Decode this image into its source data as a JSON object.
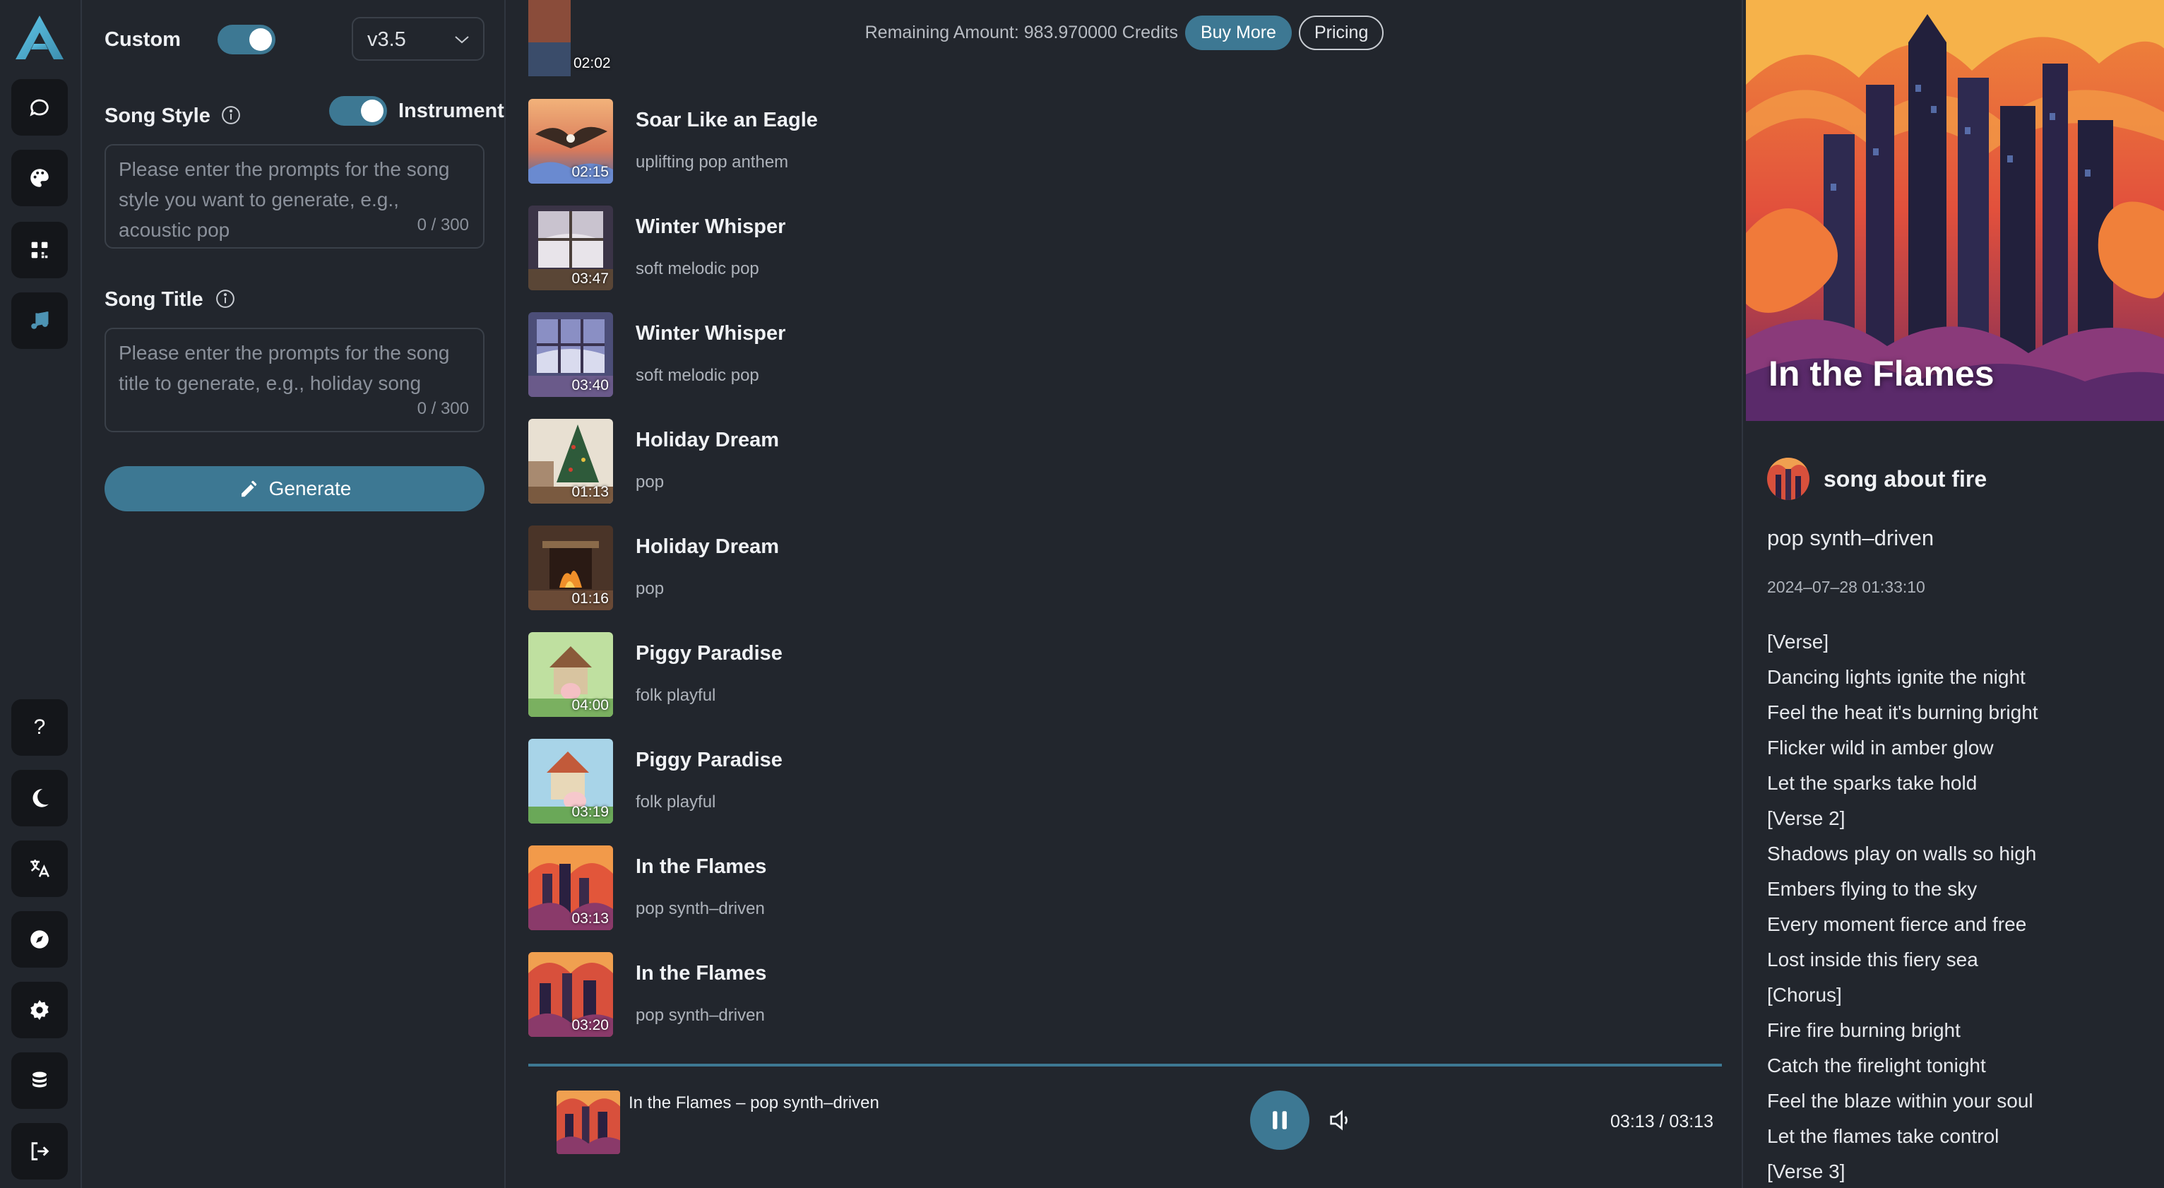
{
  "colors": {
    "accent": "#3d7893",
    "background": "#22262d",
    "rail_button": "#14161a"
  },
  "rail": {
    "top_icons": [
      "chat-icon",
      "palette-icon",
      "apps-icon",
      "music-icon"
    ],
    "bottom_icons": [
      "help-icon",
      "moon-icon",
      "translate-icon",
      "compass-icon",
      "gear-icon",
      "coins-icon",
      "logout-icon"
    ],
    "help_glyph": "?"
  },
  "form": {
    "custom_label": "Custom",
    "version": "v3.5",
    "song_style_label": "Song Style",
    "instrument_label": "Instrument",
    "style_placeholder": "Please enter the prompts for the song style you want to generate, e.g., acoustic pop",
    "style_count": "0 / 300",
    "song_title_label": "Song Title",
    "title_placeholder": "Please enter the prompts for the song title to generate, e.g., holiday song",
    "title_count": "0 / 300",
    "generate_label": "Generate"
  },
  "topbar": {
    "remaining": "Remaining Amount: 983.970000 Credits",
    "buy_more": "Buy More",
    "pricing": "Pricing"
  },
  "partial_duration": "02:02",
  "songs": [
    {
      "title": "Soar Like an Eagle",
      "style": "uplifting pop anthem",
      "duration": "02:15"
    },
    {
      "title": "Winter Whisper",
      "style": "soft melodic pop",
      "duration": "03:47"
    },
    {
      "title": "Winter Whisper",
      "style": "soft melodic pop",
      "duration": "03:40"
    },
    {
      "title": "Holiday Dream",
      "style": "pop",
      "duration": "01:13"
    },
    {
      "title": "Holiday Dream",
      "style": "pop",
      "duration": "01:16"
    },
    {
      "title": "Piggy Paradise",
      "style": "folk playful",
      "duration": "04:00"
    },
    {
      "title": "Piggy Paradise",
      "style": "folk playful",
      "duration": "03:19"
    },
    {
      "title": "In the Flames",
      "style": "pop synth–driven",
      "duration": "03:13"
    },
    {
      "title": "In the Flames",
      "style": "pop synth–driven",
      "duration": "03:20"
    }
  ],
  "player": {
    "now_playing": "In the Flames  – pop synth–driven",
    "time": "03:13 / 03:13"
  },
  "detail": {
    "cover_title": "In the Flames",
    "author": "song about fire",
    "style": "pop synth–driven",
    "date": "2024–07–28 01:33:10",
    "lyrics": [
      "[Verse]",
      "Dancing lights ignite the night",
      "Feel the heat it's burning bright",
      "Flicker wild in amber glow",
      "Let the sparks take hold",
      "[Verse 2]",
      "Shadows play on walls so high",
      "Embers flying to the sky",
      "Every moment fierce and free",
      "Lost inside this fiery sea",
      "[Chorus]",
      "Fire fire burning bright",
      "Catch the firelight tonight",
      "Feel the blaze within your soul",
      "Let the flames take control",
      "[Verse 3]"
    ]
  }
}
